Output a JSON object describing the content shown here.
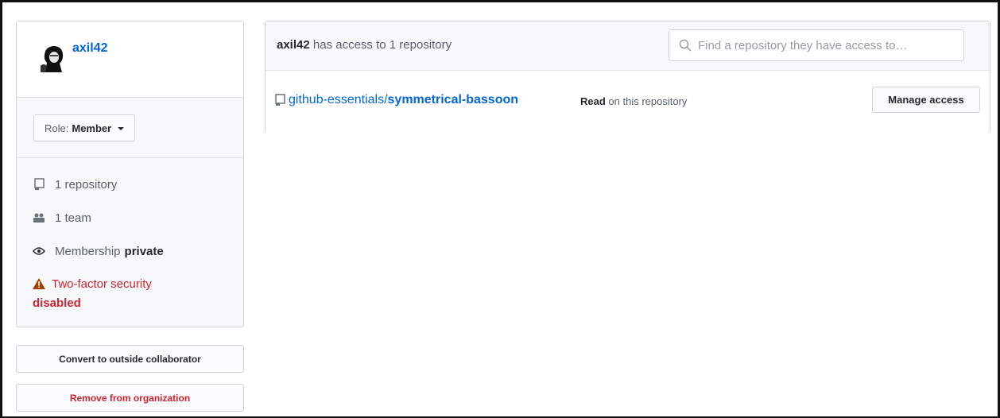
{
  "member": {
    "username": "axil42",
    "avatar_icon": "avatar-image"
  },
  "role": {
    "prefix": "Role:",
    "value": "Member"
  },
  "stats": {
    "repositories": "1 repository",
    "teams": "1 team",
    "membership_label": "Membership",
    "membership_value": "private",
    "two_factor_label": "Two-factor security",
    "two_factor_status": "disabled"
  },
  "actions": {
    "convert_label": "Convert to outside collaborator",
    "remove_label": "Remove from organization"
  },
  "access": {
    "user": "axil42",
    "summary": "has access to 1 repository",
    "search_placeholder": "Find a repository they have access to…"
  },
  "repos": [
    {
      "owner": "github-essentials/",
      "name": "symmetrical-bassoon",
      "permission": "Read",
      "permission_suffix": "on this repository",
      "manage_label": "Manage access"
    }
  ],
  "colors": {
    "link": "#0366d6",
    "danger": "#cb2431",
    "border": "#d1d5da",
    "muted": "#586069",
    "panel_bg": "#f6f8fa"
  },
  "icons": {
    "repo": "repo-icon",
    "team": "people-icon",
    "eye": "eye-icon",
    "alert": "alert-icon",
    "search": "search-icon",
    "caret": "caret-down-icon"
  }
}
